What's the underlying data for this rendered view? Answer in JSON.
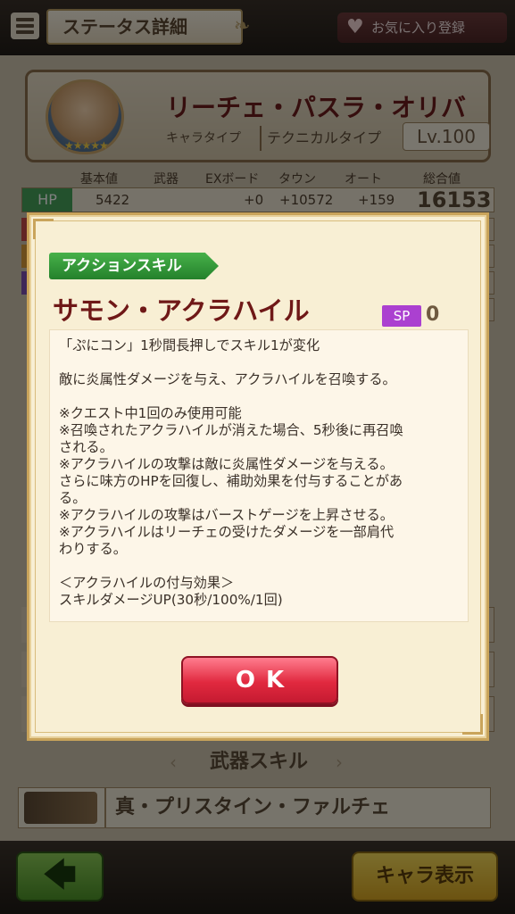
{
  "header": {
    "title": "ステータス詳細",
    "favorite_label": "お気に入り登録"
  },
  "character": {
    "name": "リーチェ・パスラ・オリバ",
    "type_label": "キャラタイプ",
    "type_value": "テクニカルタイプ",
    "level": "Lv.100",
    "stars": "★★★★★"
  },
  "stats": {
    "columns": [
      "基本値",
      "武器",
      "EXボード",
      "タウン",
      "オート",
      "総合値"
    ],
    "hp": {
      "label": "HP",
      "base": "5422",
      "weapon": "",
      "exboard": "+0",
      "town": "+10572",
      "auto": "+159",
      "total": "16153"
    }
  },
  "weapon_section": {
    "header": "武器スキル",
    "weapon_name": "真・プリスタイン・ファルチェ"
  },
  "footer": {
    "back_label": "🡄",
    "chara_button_label": "キャラ表示"
  },
  "dialog": {
    "skill_type": "アクションスキル",
    "skill_name": "サモン・アクラハイル",
    "sp_label": "SP",
    "sp_value": "0",
    "description_lines": [
      "「ぷにコン」1秒間長押しでスキル1が変化",
      "",
      "敵に炎属性ダメージを与え、アクラハイルを召喚する。",
      "",
      "※クエスト中1回のみ使用可能",
      "※召喚されたアクラハイルが消えた場合、5秒後に再召喚",
      "される。",
      "※アクラハイルの攻撃は敵に炎属性ダメージを与える。",
      "さらに味方のHPを回復し、補助効果を付与することがあ",
      "る。",
      "※アクラハイルの攻撃はバーストゲージを上昇させる。",
      "※アクラハイルはリーチェの受けたダメージを一部肩代",
      "わりする。",
      "",
      "＜アクラハイルの付与効果＞",
      "スキルダメージUP(30秒/100%/1回)"
    ],
    "ok_label": "OK"
  },
  "colors": {
    "skill_name": "#6f1817",
    "skill_type_tag": "#24812b",
    "sp_badge": "#ab40d0",
    "ok_button": "#e1293f"
  }
}
